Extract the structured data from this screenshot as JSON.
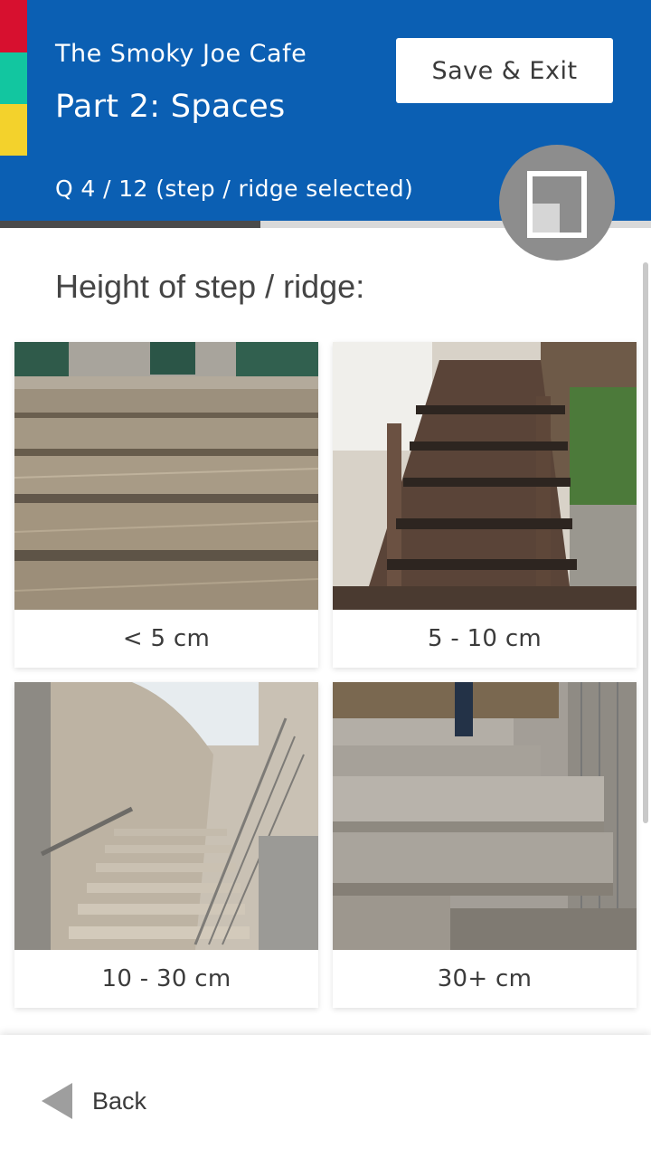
{
  "header": {
    "venue": "The Smoky Joe Cafe",
    "part": "Part 2: Spaces",
    "question_counter": "Q 4 / 12 (step / ridge selected)",
    "save_label": "Save & Exit",
    "progress_fraction": 0.4,
    "accent_colors": [
      "#d7102f",
      "#12c6a0",
      "#f3d22c"
    ],
    "background_color": "#0b5fb3"
  },
  "question": {
    "title": "Height of step / ridge:"
  },
  "options": [
    {
      "label": "< 5 cm"
    },
    {
      "label": "5 - 10 cm"
    },
    {
      "label": "10 - 30 cm"
    },
    {
      "label": "30+ cm"
    }
  ],
  "footer": {
    "back_label": "Back"
  },
  "icons": {
    "badge": "floorplan-icon",
    "back": "back-arrow-icon"
  }
}
